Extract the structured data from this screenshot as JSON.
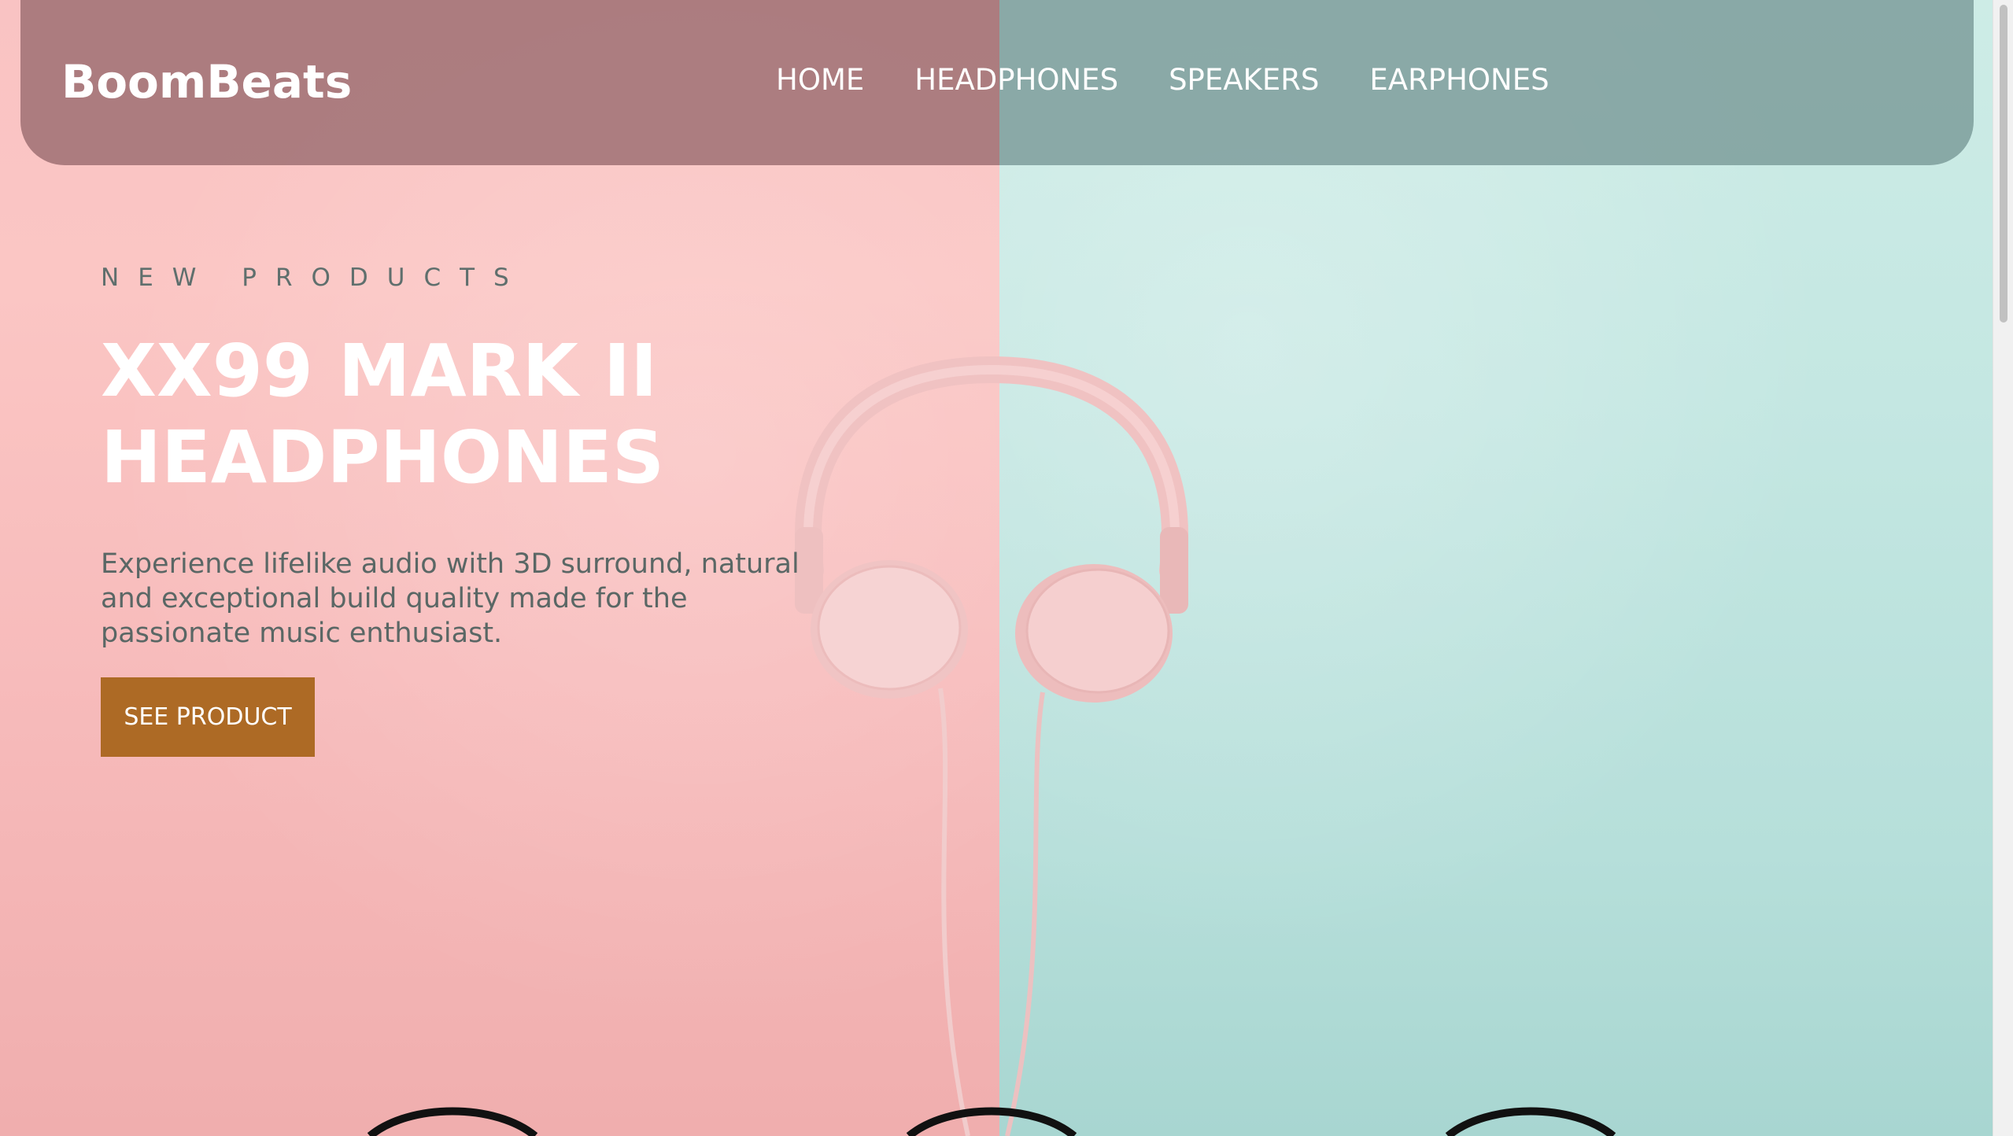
{
  "nav": {
    "brand": "BoomBeats",
    "links": [
      "HOME",
      "HEADPHONES",
      "SPEAKERS",
      "EARPHONES"
    ]
  },
  "hero": {
    "eyebrow": "NEW PRODUCTS",
    "title_line1": "XX99 MARK II",
    "title_line2": "HEADPHONES",
    "description": "Experience lifelike audio with 3D surround, natural and exceptional build quality made for the passionate music enthusiast.",
    "cta_label": "SEE PRODUCT"
  },
  "colors": {
    "accent": "#ad6a25",
    "left_background": "#f9c3c3",
    "right_background": "#c4e7e2"
  },
  "icons": {
    "product_image": "headphones-icon"
  }
}
